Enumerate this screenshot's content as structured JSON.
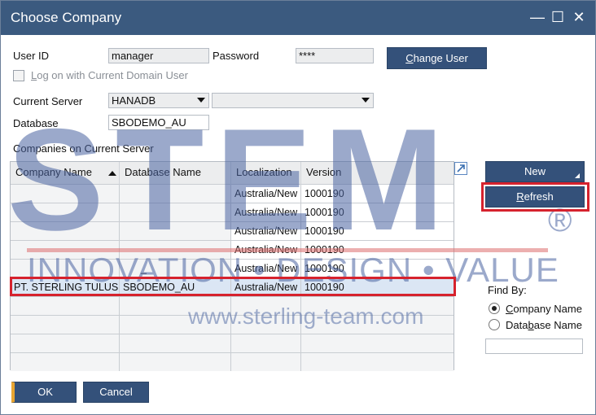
{
  "window": {
    "title": "Choose Company",
    "minimize": "—",
    "maximize": "☐",
    "close": "✕"
  },
  "login": {
    "user_id_label": "User ID",
    "user_id_value": "manager",
    "password_label": "Password",
    "password_value": "****",
    "change_user_prefix": "C",
    "change_user_label": "hange User",
    "domain_checkbox_prefix": "L",
    "domain_checkbox_label": "og on with Current Domain User",
    "domain_checkbox_checked": false
  },
  "server": {
    "current_server_label": "Current Server",
    "current_server_value": "HANADB",
    "database_label": "Database",
    "database_value": "SBODEMO_AU"
  },
  "companies": {
    "section_label": "Companies on Current Server",
    "columns": [
      "Company Name",
      "Database Name",
      "Localization",
      "Version"
    ],
    "rows": [
      {
        "company": "",
        "database": "",
        "localization": "Australia/New Z",
        "version": "1000190"
      },
      {
        "company": "",
        "database": "",
        "localization": "Australia/New Z",
        "version": "1000190"
      },
      {
        "company": "",
        "database": "",
        "localization": "Australia/New Z",
        "version": "1000190"
      },
      {
        "company": "",
        "database": "",
        "localization": "Australia/New Z",
        "version": "1000190"
      },
      {
        "company": "",
        "database": "_",
        "localization": "Australia/New Z",
        "version": "1000190"
      },
      {
        "company": "PT. STERLING TULUS",
        "database": "SBODEMO_AU",
        "localization": "Australia/New Z",
        "version": "1000190"
      }
    ],
    "selected_row": 5
  },
  "actions": {
    "new_label": "New",
    "refresh_prefix": "R",
    "refresh_label": "efresh"
  },
  "find_by": {
    "label": "Find By:",
    "options": [
      {
        "prefix": "C",
        "label": "ompany Name",
        "selected": true
      },
      {
        "prefix": "Data",
        "label_mid": "b",
        "label": "ase Name",
        "selected": false
      }
    ],
    "search_value": ""
  },
  "footer": {
    "ok_label": "OK",
    "cancel_label": "Cancel"
  },
  "watermark": {
    "logo": "STEM",
    "registered": "®",
    "tagline": "INNOVATION • DESIGN • VALUE",
    "url": "www.sterling-team.com"
  },
  "colors": {
    "title_bar": "#3b5a7f",
    "button": "#34517a",
    "highlight_border": "#d6222d",
    "selected_row": "#dbe6f4"
  }
}
